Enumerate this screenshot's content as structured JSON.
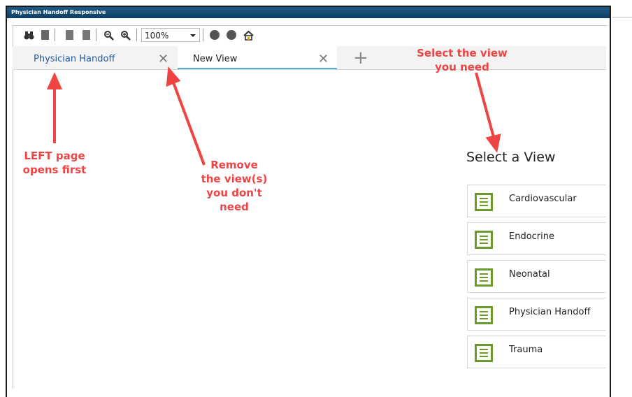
{
  "window": {
    "title": "Physician Handoff Responsive"
  },
  "toolbar": {
    "zoom_value": "100%"
  },
  "tabs": [
    {
      "label": "Physician Handoff",
      "close": "✕"
    },
    {
      "label": "New View",
      "close": "✕"
    }
  ],
  "add_tab": "+",
  "view_selector": {
    "title": "Select a View",
    "views": [
      "Cardiovascular",
      "Endocrine",
      "Neonatal",
      "Physician Handoff",
      "Trauma"
    ]
  },
  "annotations": {
    "select_view": [
      "Select the view",
      "you need"
    ],
    "left_page": [
      "LEFT page",
      "opens first"
    ],
    "remove_view": [
      "Remove",
      "the view(s)",
      "you don't",
      "need"
    ]
  },
  "colors": {
    "annotation": "#ee4444",
    "title_bar": "#1b5683",
    "view_icon": "#6a9a2c",
    "active_tab_underline": "#5aa7da"
  }
}
